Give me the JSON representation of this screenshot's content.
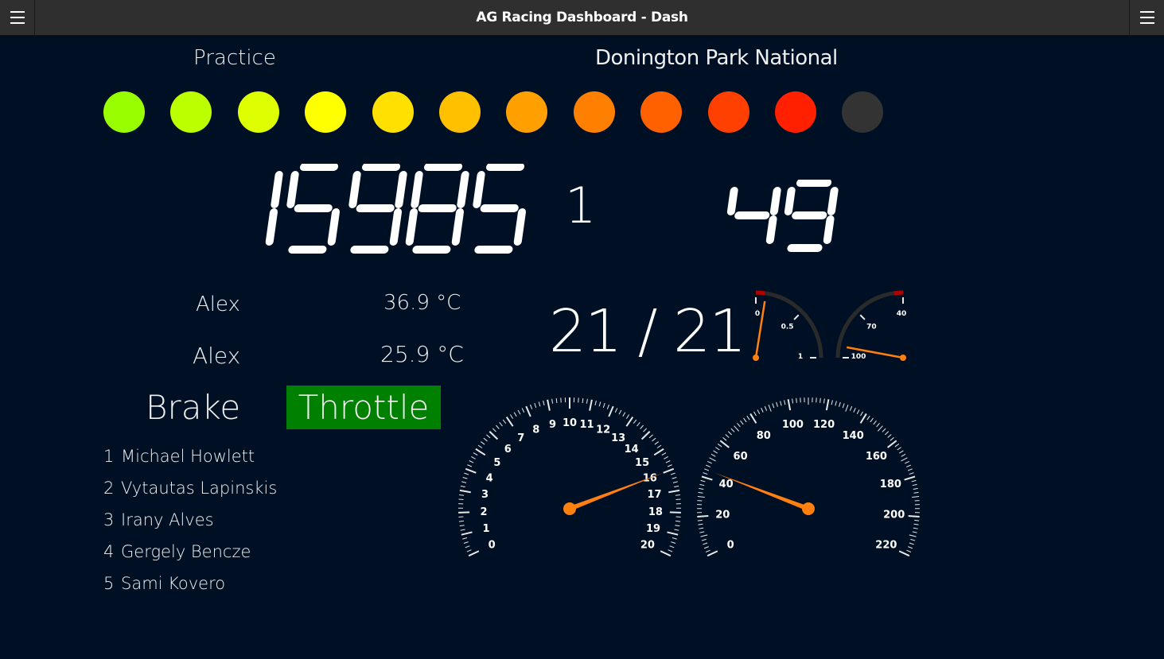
{
  "app": {
    "title": "AG Racing Dashboard - Dash"
  },
  "header": {
    "session": "Practice",
    "track": "Donington Park National"
  },
  "shift_lights": [
    "#99ff00",
    "#bbff00",
    "#ddff00",
    "#ffff00",
    "#ffe000",
    "#ffc000",
    "#ffa000",
    "#ff8000",
    "#ff6000",
    "#ff4000",
    "#ff2000",
    "#333333"
  ],
  "display": {
    "rpm": "15985",
    "gear": "1",
    "speed": "49"
  },
  "info": {
    "row1_name": "Alex",
    "row1_temp": "36.9 °C",
    "row2_name": "Alex",
    "row2_temp": "25.9 °C"
  },
  "lap": {
    "text": "21 / 21"
  },
  "pedals": {
    "brake": "Brake",
    "throttle": "Throttle",
    "throttle_color": "#008000"
  },
  "standings": [
    {
      "pos": "1",
      "name": "Michael Howlett"
    },
    {
      "pos": "2",
      "name": "Vytautas Lapinskis"
    },
    {
      "pos": "3",
      "name": "Irany Alves"
    },
    {
      "pos": "4",
      "name": "Gergely Bencze"
    },
    {
      "pos": "5",
      "name": "Sami Kovero"
    }
  ],
  "small_gauges": [
    {
      "labels": [
        "0",
        "0.5",
        "1"
      ],
      "value": 0.1
    },
    {
      "labels": [
        "40",
        "70",
        "100"
      ],
      "value": 93
    }
  ],
  "tacho": {
    "labels": [
      "0",
      "1",
      "2",
      "3",
      "4",
      "5",
      "6",
      "7",
      "8",
      "9",
      "10",
      "11",
      "12",
      "13",
      "14",
      "15",
      "16",
      "17",
      "18",
      "19",
      "20"
    ],
    "value": 16
  },
  "speedo": {
    "labels": [
      "0",
      "20",
      "40",
      "60",
      "80",
      "100",
      "120",
      "140",
      "160",
      "180",
      "200",
      "220"
    ],
    "value": 44
  },
  "colors": {
    "needle": "#ff7f0f",
    "background": "#001024",
    "redzone": "#b00000"
  }
}
